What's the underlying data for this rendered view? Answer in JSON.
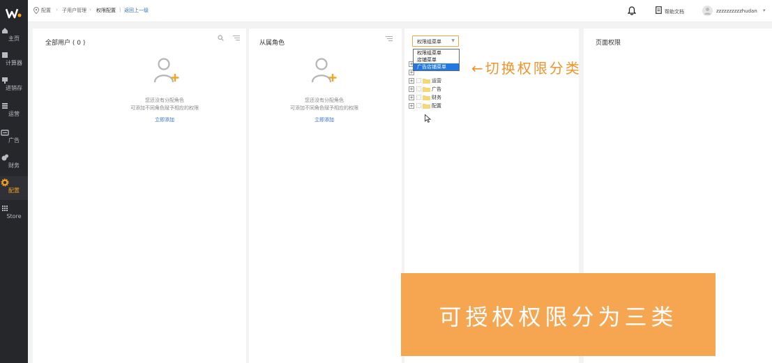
{
  "sidebar": {
    "items": [
      {
        "label": "主页",
        "icon": "home-icon"
      },
      {
        "label": "计算器",
        "icon": "calculator-icon"
      },
      {
        "label": "进销存",
        "icon": "inventory-icon"
      },
      {
        "label": "运营",
        "icon": "operations-icon"
      },
      {
        "label": "广告",
        "icon": "ads-icon"
      },
      {
        "label": "财务",
        "icon": "finance-icon"
      },
      {
        "label": "配置",
        "icon": "gear-icon",
        "active": true
      },
      {
        "label": "Store",
        "icon": "grid-icon"
      }
    ]
  },
  "breadcrumb": {
    "items": [
      "配置",
      "子用户管理",
      "权限配置"
    ],
    "back_label": "返回上一级"
  },
  "header": {
    "help_label": "帮助文档",
    "username": "zzzzzzzzzzhudan"
  },
  "panels": {
    "users": {
      "title": "全部用户 ( 0 )",
      "empty_line1": "您还没有分配角色",
      "empty_line2": "可添加不同角色赋予相应的权限",
      "add_label": "立即添加"
    },
    "roles": {
      "title": "从属角色",
      "empty_line1": "您还没有分配角色",
      "empty_line2": "可添加不同角色赋予相应的权限",
      "add_label": "立即添加"
    },
    "page_perms": {
      "title": "页面权限"
    }
  },
  "menu_select": {
    "value": "权限组菜单",
    "options": [
      "权限组菜单",
      "店铺菜单",
      "广告店铺菜单"
    ],
    "highlighted_index": 2
  },
  "tree": {
    "items": [
      "运营",
      "广告",
      "财务",
      "配置"
    ]
  },
  "annotations": {
    "arrow_note": "←切换权限分类",
    "banner": "可授权权限分为三类"
  },
  "colors": {
    "accent": "#f5a21f",
    "link": "#2e6fd1",
    "banner": "#f6a650",
    "sidebar": "#25272b"
  }
}
